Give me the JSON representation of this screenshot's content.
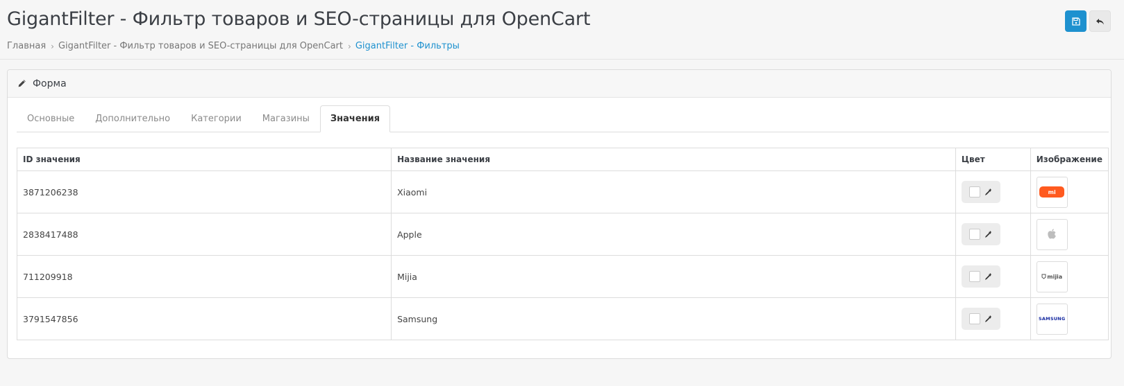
{
  "header": {
    "title": "GigantFilter - Фильтр товаров и SEO-страницы для OpenCart",
    "breadcrumbs": [
      {
        "label": "Главная"
      },
      {
        "label": "GigantFilter - Фильтр товаров и SEO-страницы для OpenCart"
      },
      {
        "label": "GigantFilter - Фильтры"
      }
    ],
    "save_icon": "floppy-disk-icon",
    "back_icon": "reply-arrow-icon",
    "accent_color": "#1e91cf"
  },
  "card": {
    "title": "Форма",
    "icon": "pencil-icon"
  },
  "tabs": [
    {
      "label": "Основные",
      "active": false
    },
    {
      "label": "Дополнительно",
      "active": false
    },
    {
      "label": "Категории",
      "active": false
    },
    {
      "label": "Магазины",
      "active": false
    },
    {
      "label": "Значения",
      "active": true
    }
  ],
  "table": {
    "headers": {
      "id": "ID значения",
      "name": "Название значения",
      "color": "Цвет",
      "image": "Изображение"
    },
    "rows": [
      {
        "id": "3871206238",
        "name": "Xiaomi",
        "image_logo": "mi"
      },
      {
        "id": "2838417488",
        "name": "Apple",
        "image_logo": "apple"
      },
      {
        "id": "711209918",
        "name": "Mijia",
        "image_logo": "mijia"
      },
      {
        "id": "3791547856",
        "name": "Samsung",
        "image_logo": "SAMSUNG"
      }
    ]
  }
}
